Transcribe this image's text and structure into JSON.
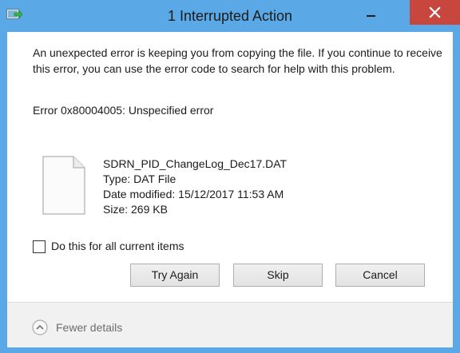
{
  "window": {
    "title": "1 Interrupted Action",
    "icons": {
      "app": "file-transfer-icon",
      "minimize": "minimize-icon",
      "close": "close-icon"
    },
    "colors": {
      "frame": "#5aa9e6",
      "close_button": "#c7473e"
    }
  },
  "dialog": {
    "message": "An unexpected error is keeping you from copying the file. If you continue to receive this error, you can use the error code to search for help with this problem.",
    "error_text": "Error 0x80004005: Unspecified error",
    "file": {
      "icon": "blank-file-icon",
      "name": "SDRN_PID_ChangeLog_Dec17.DAT",
      "type": "Type: DAT File",
      "date_modified": "Date modified: 15/12/2017 11:53 AM",
      "size": "Size: 269 KB"
    },
    "apply_all": {
      "label": "Do this for all current items",
      "checked": false
    },
    "buttons": {
      "try_again": "Try Again",
      "skip": "Skip",
      "cancel": "Cancel"
    },
    "footer": {
      "toggle_label": "Fewer details",
      "icon": "chevron-up-icon"
    }
  }
}
